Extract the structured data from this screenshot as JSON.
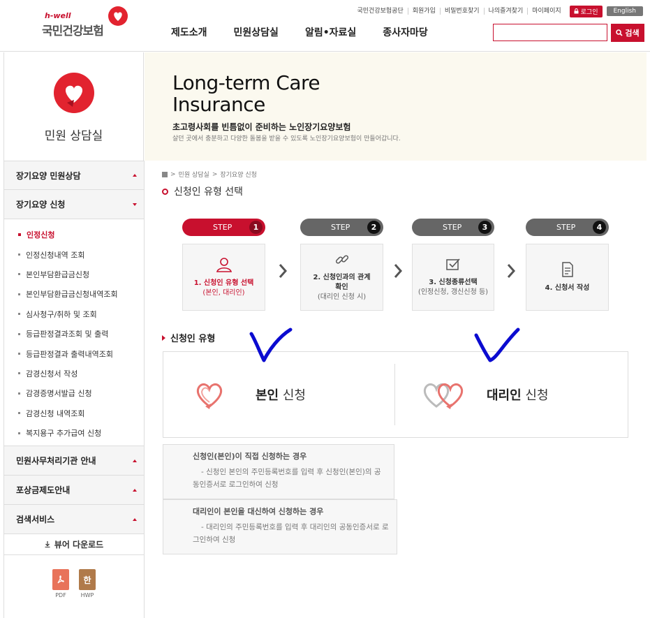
{
  "header": {
    "logo_tagline": "h-well",
    "logo_name": "국민건강보험",
    "util_links": [
      "국민건강보험공단",
      "회원가입",
      "비밀번호찾기",
      "나의즐겨찾기",
      "마이페이지"
    ],
    "login_label": "로그인",
    "english_label": "English",
    "gnb": [
      "제도소개",
      "민원상담실",
      "알림•자료실",
      "종사자마당"
    ],
    "search_placeholder": "",
    "search_button": "검색"
  },
  "sidebar": {
    "title": "민원 상담실",
    "groups": [
      {
        "label": "장기요양 민원상담"
      },
      {
        "label": "장기요양 신청"
      }
    ],
    "sub_items": [
      "인정신청",
      "인정신청내역 조회",
      "본인부담환급금신청",
      "본인부담환급금신청내역조회",
      "심사청구/취하 및 조회",
      "등급판정결과조회 및 출력",
      "등급판정결과 출력내역조회",
      "감경신청서 작성",
      "감경증명서발급 신청",
      "감경신청 내역조회",
      "복지용구 추가급여 신청"
    ],
    "groups_after": [
      "민원사무처리기관 안내",
      "포상금제도안내",
      "검색서비스"
    ],
    "viewer_download": "뷰어 다운로드",
    "files": [
      {
        "label": "PDF",
        "glyph": "",
        "color": "#e8735a"
      },
      {
        "label": "HWP",
        "glyph": "한",
        "color": "#b07a4a"
      }
    ]
  },
  "banner": {
    "title_line1": "Long-term Care",
    "title_line2": "Insurance",
    "subtitle": "초고령사회를 빈틈없이 준비하는 노인장기요양보험",
    "description": "살던 곳에서 충분하고 다양한 돌봄을 받을 수 있도록 노인장기요양보험이 만들어갑니다."
  },
  "breadcrumb": [
    "민원 상담실",
    "장기요양 신청"
  ],
  "page_title": "신청인 유형 선택",
  "steps": [
    {
      "pill": "STEP",
      "num": "1",
      "label": "1. 신청인 유형 선택",
      "note": "(본인, 대리인)",
      "icon": "person-icon",
      "active": true
    },
    {
      "pill": "STEP",
      "num": "2",
      "label": "2. 신청인과의 관계 확인",
      "note": "(대리인 신청 시)",
      "icon": "link-icon",
      "active": false
    },
    {
      "pill": "STEP",
      "num": "3",
      "label": "3. 신청종류선택",
      "note": "(인정신청, 갱신신청 등)",
      "icon": "checkbox-icon",
      "active": false
    },
    {
      "pill": "STEP",
      "num": "4",
      "label": "4. 신청서 작성",
      "note": "",
      "icon": "document-icon",
      "active": false
    }
  ],
  "section_title": "신청인 유형",
  "options": {
    "self": {
      "bold": "본인",
      "rest": " 신청"
    },
    "agent": {
      "bold": "대리인",
      "rest": " 신청"
    }
  },
  "info": [
    {
      "head": "신청인(본인)이 직접 신청하는 경우",
      "body": "- 신청인 본인의 주민등록번호를 입력 후 신청인(본인)의 공동인증서로 로그인하여 신청"
    },
    {
      "head": "대리인이 본인을 대신하여 신청하는 경우",
      "body": "- 대리인의 주민등록번호를 입력 후 대리인의 공동인증서로 로그인하여 신청"
    }
  ],
  "colors": {
    "brand": "#c8102e",
    "step_inactive": "#666666",
    "annotation": "#0b0bd0"
  }
}
